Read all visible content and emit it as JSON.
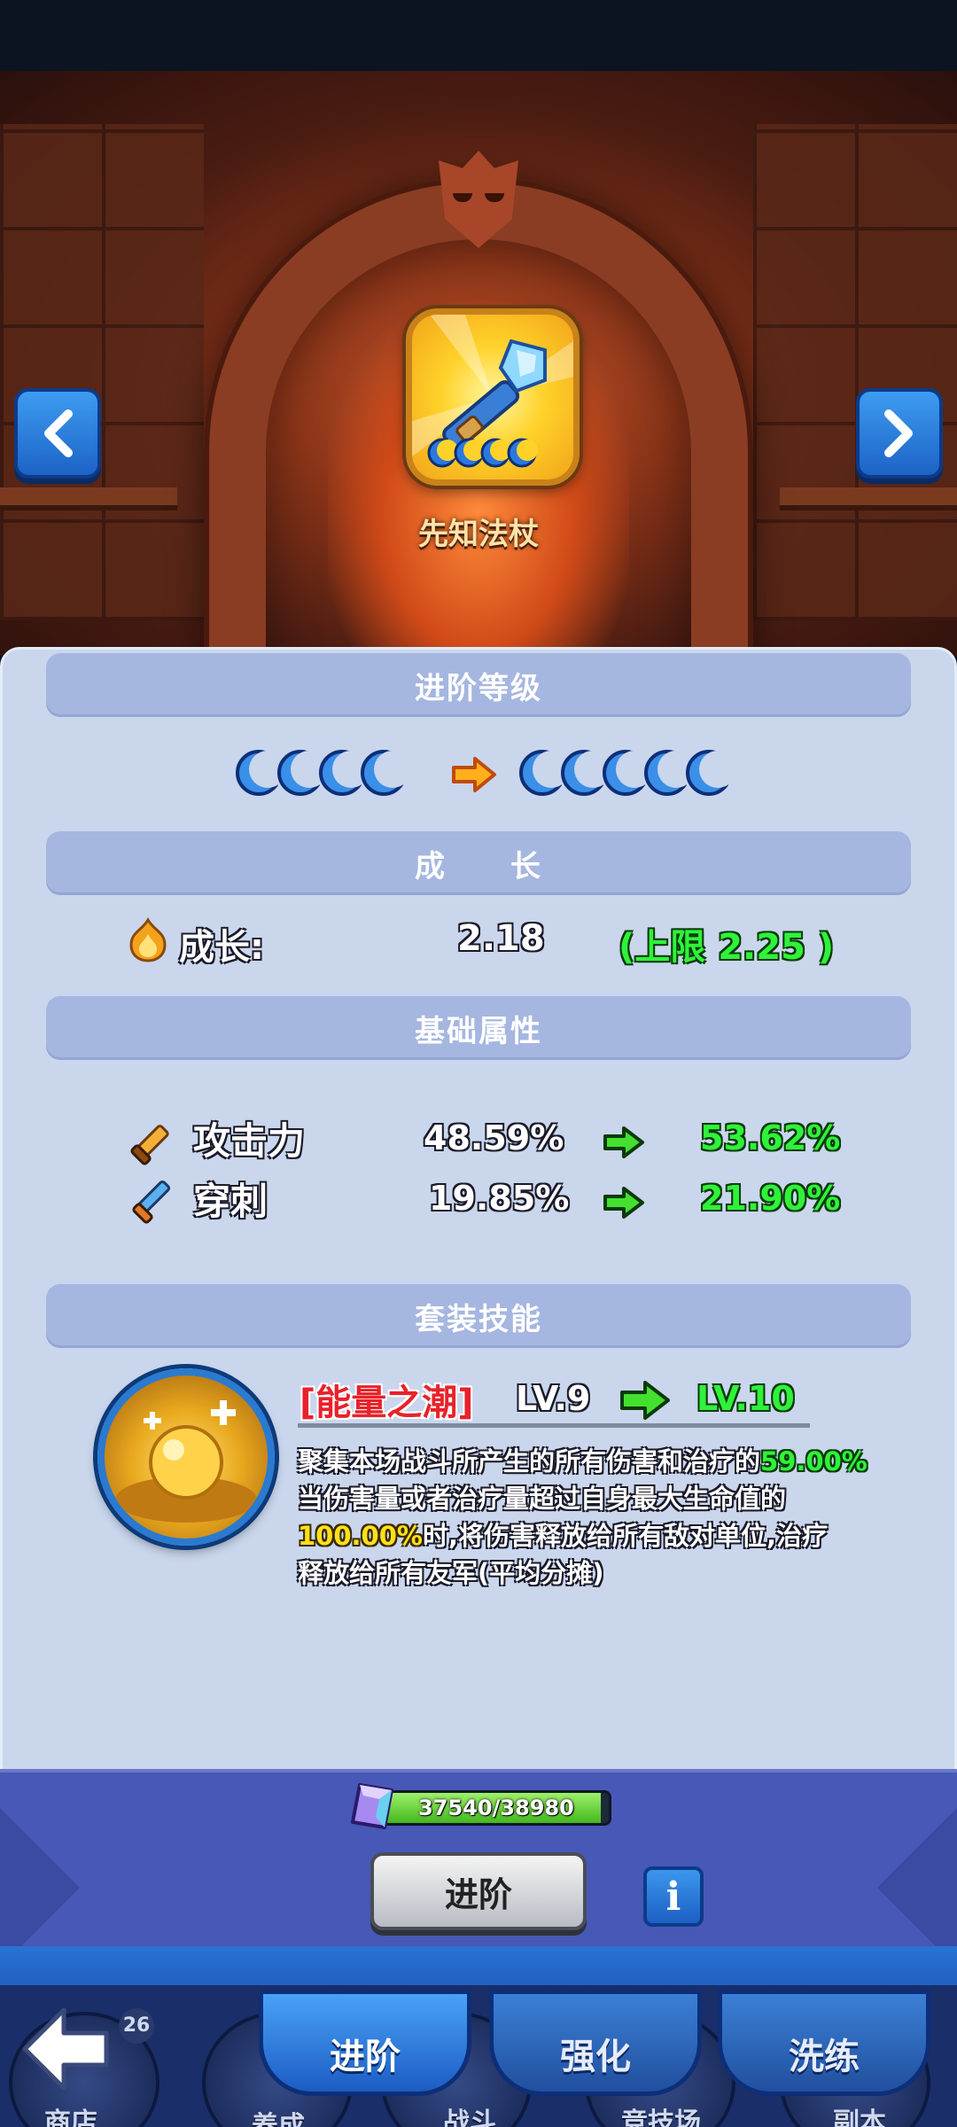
{
  "item": {
    "name": "先知法杖"
  },
  "sections": {
    "advance_level": "进阶等级",
    "growth": "成　　长",
    "base_attr": "基础属性",
    "set_skill": "套装技能"
  },
  "growth": {
    "label": "成长:",
    "value": "2.18",
    "limit": "(上限  2.25 )"
  },
  "attributes": [
    {
      "name": "攻击力",
      "current": "48.59%",
      "next": "53.62%"
    },
    {
      "name": "穿刺",
      "current": "19.85%",
      "next": "21.90%"
    }
  ],
  "skill": {
    "name": "[能量之潮]",
    "current_level": "LV.9",
    "next_level": "LV.10",
    "description": {
      "line1_a": "聚集本场战斗所产生的所有伤害和治疗的",
      "line1_pct": "59.00%",
      "line2": "当伤害量或者治疗量超过自身最大生命值的",
      "line3_pct": "100.00%",
      "line3_b": "时,将伤害释放给所有敌对单位,治疗",
      "line4": "释放给所有友军(平均分摊)"
    }
  },
  "cost": {
    "current": 37540,
    "required": 38980,
    "text": "37540/38980",
    "fill_fraction": 0.963
  },
  "buttons": {
    "advance": "进阶",
    "info": "i"
  },
  "tabs": [
    "进阶",
    "强化",
    "洗练"
  ],
  "bottom_nav": [
    "商店",
    "养成",
    "战斗",
    "竞技场",
    "副本"
  ],
  "bottom_nav_badge": "26",
  "colors": {
    "panel": "#c9d6ec",
    "section_head": "#a5b6e0",
    "green": "#2ff23a",
    "yellow": "#ffe01a",
    "tab_blue": "#2a73d4"
  }
}
